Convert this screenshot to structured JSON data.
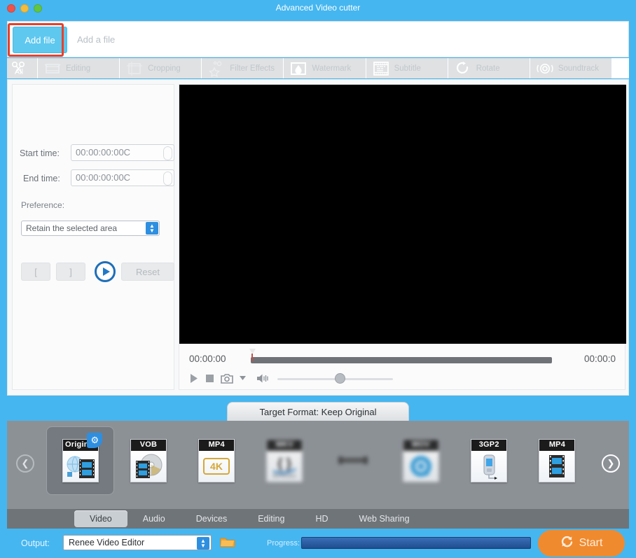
{
  "window": {
    "title": "Advanced Video cutter",
    "controls": [
      "close",
      "minimize",
      "zoom"
    ]
  },
  "filebar": {
    "add_file_label": "Add file",
    "placeholder": "Add a file"
  },
  "tooltabs": [
    {
      "label": "All",
      "icon": "scissors-all-icon",
      "is_all": true
    },
    {
      "label": "Editing",
      "icon": "editing-icon"
    },
    {
      "label": "Cropping",
      "icon": "cropping-icon"
    },
    {
      "label": "Filter Effects",
      "icon": "filter-effects-icon"
    },
    {
      "label": "Watermark",
      "icon": "watermark-icon"
    },
    {
      "label": "Subtitle",
      "icon": "subtitle-icon"
    },
    {
      "label": "Rotate",
      "icon": "rotate-icon"
    },
    {
      "label": "Soundtrack",
      "icon": "soundtrack-icon"
    }
  ],
  "editor": {
    "start_time_label": "Start time:",
    "start_time_value": "00:00:00:00C",
    "end_time_label": "End time:",
    "end_time_value": "00:00:00:00C",
    "preference_label": "Preference:",
    "preference_value": "Retain the selected area",
    "mark_in_label": "[",
    "mark_out_label": "]",
    "preview_icon": "play-preview-icon",
    "reset_label": "Reset"
  },
  "player": {
    "current_time": "00:00:00",
    "total_time": "00:00:0",
    "play_icon": "play-icon",
    "stop_icon": "stop-icon",
    "snapshot_icon": "camera-icon",
    "snapshot_menu_icon": "chevron-down-icon",
    "volume_icon": "volume-icon"
  },
  "target_format": {
    "banner": "Target Format: Keep Original"
  },
  "formats": [
    {
      "caption": "Original",
      "art": "original",
      "selected": true,
      "badge_icon": "gear-icon"
    },
    {
      "caption": "VOB",
      "art": "disc"
    },
    {
      "caption": "MP4",
      "art": "4k"
    },
    {
      "caption": "MKV",
      "art": "matroska",
      "sub": "MATROSKA",
      "blurred": true
    },
    {
      "caption": "",
      "art": "blurred-thumb",
      "blurred": true
    },
    {
      "caption": "MOV",
      "art": "quicktime",
      "blurred": true
    },
    {
      "caption": "3GP2",
      "art": "phone"
    },
    {
      "caption": "MP4",
      "art": "film"
    }
  ],
  "carousel": {
    "prev_icon": "chevron-left-icon",
    "next_icon": "chevron-right-icon"
  },
  "categories": [
    {
      "label": "Video",
      "active": true
    },
    {
      "label": "Audio",
      "active": false
    },
    {
      "label": "Devices",
      "active": false
    },
    {
      "label": "Editing",
      "active": false
    },
    {
      "label": "HD",
      "active": false
    },
    {
      "label": "Web Sharing",
      "active": false
    }
  ],
  "output": {
    "label": "Output:",
    "value": "Renee Video Editor",
    "folder_icon": "folder-icon",
    "progress_label": "Progress:",
    "progress_percent": 100,
    "start_label": "Start",
    "start_icon": "refresh-icon"
  },
  "colors": {
    "accent_blue": "#45b6f0",
    "start_orange": "#f08a2e",
    "highlight_red": "#e8402a",
    "carousel_gray": "#8c9196"
  }
}
